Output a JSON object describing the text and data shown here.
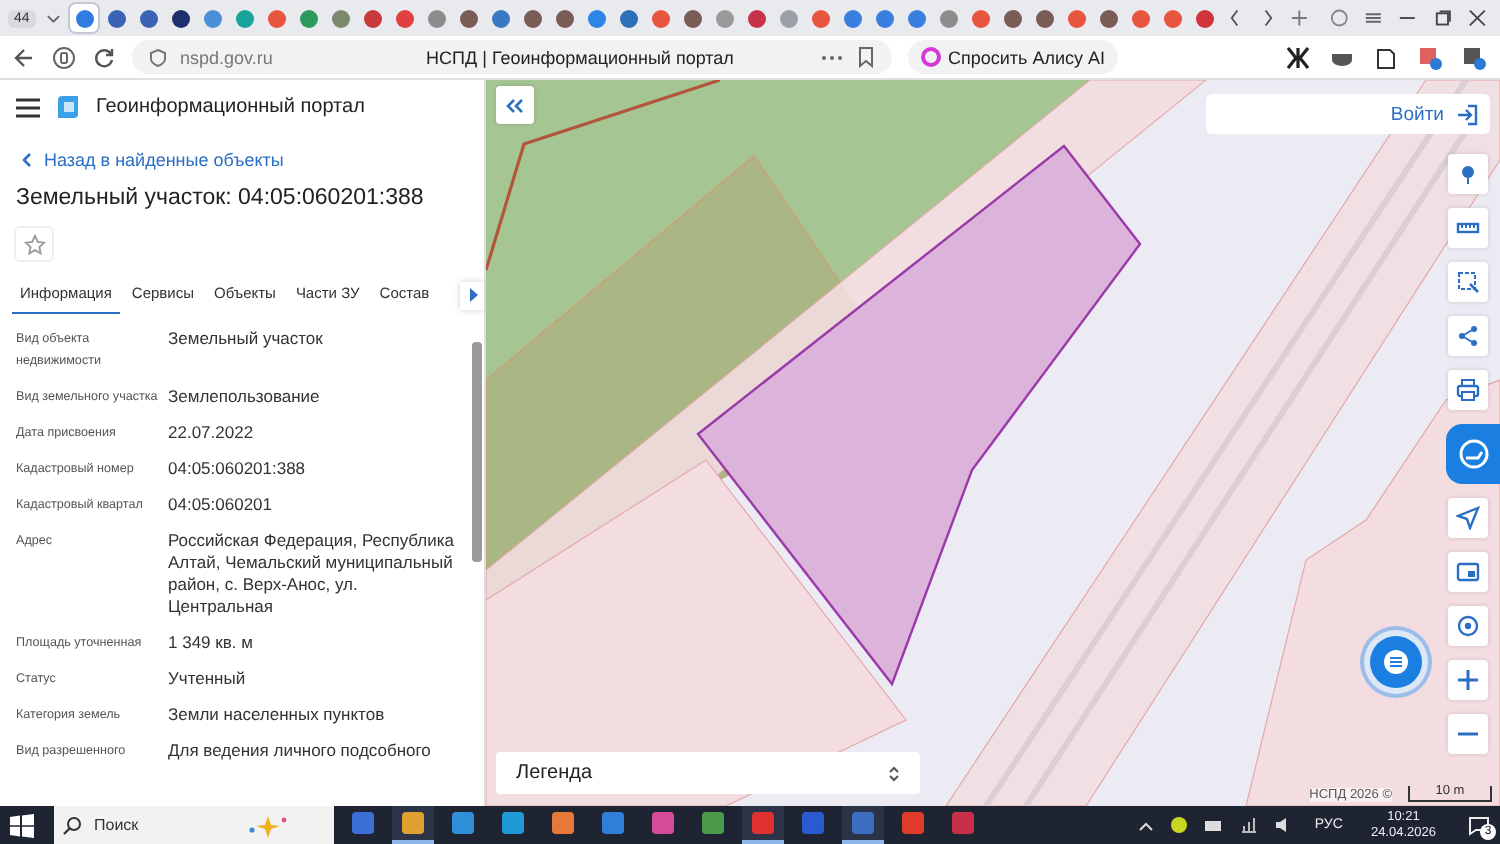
{
  "browser": {
    "tab_counter": "44",
    "tabs": [
      {
        "color": "#2f7de1",
        "selected": true
      },
      {
        "color": "#3a62b5",
        "selected": false
      },
      {
        "color": "#3a62b5",
        "selected": false
      },
      {
        "color": "#1f2f6e",
        "selected": false
      },
      {
        "color": "#4a8fd8",
        "selected": false
      },
      {
        "color": "#1aa39a",
        "selected": false
      },
      {
        "color": "#e8553e",
        "selected": false
      },
      {
        "color": "#2a9a5a",
        "selected": false
      },
      {
        "color": "#7b8a6e",
        "selected": false
      },
      {
        "color": "#c83a3a",
        "selected": false
      },
      {
        "color": "#e04040",
        "selected": false
      },
      {
        "color": "#8c8c8c",
        "selected": false
      },
      {
        "color": "#7a5c55",
        "selected": false
      },
      {
        "color": "#3b78c4",
        "selected": false
      },
      {
        "color": "#7a5c55",
        "selected": false
      },
      {
        "color": "#7a5c55",
        "selected": false
      },
      {
        "color": "#2c86e6",
        "selected": false
      },
      {
        "color": "#2c6fb8",
        "selected": false
      },
      {
        "color": "#e8553e",
        "selected": false
      },
      {
        "color": "#7a5c55",
        "selected": false
      },
      {
        "color": "#9a9a9a",
        "selected": false
      },
      {
        "color": "#c8334a",
        "selected": false
      },
      {
        "color": "#9aa0a8",
        "selected": false
      },
      {
        "color": "#e8553e",
        "selected": false
      },
      {
        "color": "#3a7fe0",
        "selected": false
      },
      {
        "color": "#3a7fe0",
        "selected": false
      },
      {
        "color": "#3a7fe0",
        "selected": false
      },
      {
        "color": "#8c8c8c",
        "selected": false
      },
      {
        "color": "#e8553e",
        "selected": false
      },
      {
        "color": "#7a5c55",
        "selected": false
      },
      {
        "color": "#7a5c55",
        "selected": false
      },
      {
        "color": "#e8553e",
        "selected": false
      },
      {
        "color": "#7a5c55",
        "selected": false
      },
      {
        "color": "#e8553e",
        "selected": false
      },
      {
        "color": "#e8553e",
        "selected": false
      },
      {
        "color": "#d0343a",
        "selected": false
      }
    ],
    "url": "nspd.gov.ru",
    "page_title": "НСПД | Геоинформационный портал",
    "alice_button": "Спросить Алису AI"
  },
  "portal": {
    "title": "Геоинформационный портал"
  },
  "panel": {
    "back_link": "Назад в найденные объекты",
    "heading": "Земельный участок: 04:05:060201:388",
    "starred": false,
    "tabs": [
      {
        "label": "Информация",
        "selected": true
      },
      {
        "label": "Сервисы",
        "selected": false
      },
      {
        "label": "Объекты",
        "selected": false
      },
      {
        "label": "Части ЗУ",
        "selected": false
      },
      {
        "label": "Состав",
        "selected": false
      }
    ],
    "properties": [
      {
        "label": "Вид объекта недвижимости",
        "value": "Земельный участок"
      },
      {
        "label": "Вид земельного участка",
        "value": "Землепользование"
      },
      {
        "label": "Дата присвоения",
        "value": "22.07.2022"
      },
      {
        "label": "Кадастровый номер",
        "value": "04:05:060201:388"
      },
      {
        "label": "Кадастровый квартал",
        "value": "04:05:060201"
      },
      {
        "label": "Адрес",
        "value": "Российская Федерация, Республика Алтай, Чемальский муниципальный район, с. Верх-Анос, ул. Центральная"
      },
      {
        "label": "Площадь уточненная",
        "value": "1 349 кв. м"
      },
      {
        "label": "Статус",
        "value": "Учтенный"
      },
      {
        "label": "Категория земель",
        "value": "Земли населенных пунктов"
      },
      {
        "label": "Вид разрешенного",
        "value": "Для ведения личного подсобного"
      }
    ]
  },
  "map": {
    "login": "Войти",
    "legend": "Легенда",
    "copyright": "НСПД 2026 ©",
    "scale": "10 m"
  },
  "taskbar": {
    "search_placeholder": "Поиск",
    "apps": [
      {
        "color": "#3b6fd8",
        "selected": false
      },
      {
        "color": "#e0a030",
        "selected": true
      },
      {
        "color": "#2f8fd8",
        "selected": false
      },
      {
        "color": "#1f9ad6",
        "selected": false
      },
      {
        "color": "#e8783a",
        "selected": false
      },
      {
        "color": "#2f7fd8",
        "selected": false
      },
      {
        "color": "#d64a9a",
        "selected": false
      },
      {
        "color": "#4a9a4a",
        "selected": false
      },
      {
        "color": "#e03030",
        "selected": true
      },
      {
        "color": "#2a5ad0",
        "selected": false
      },
      {
        "color": "#3a6fc0",
        "selected": true
      },
      {
        "color": "#e03a2a",
        "selected": false
      },
      {
        "color": "#c8304a",
        "selected": false
      }
    ],
    "language": "РУС",
    "time": "10:21",
    "date": "24.04.2026",
    "notifications": "3"
  }
}
